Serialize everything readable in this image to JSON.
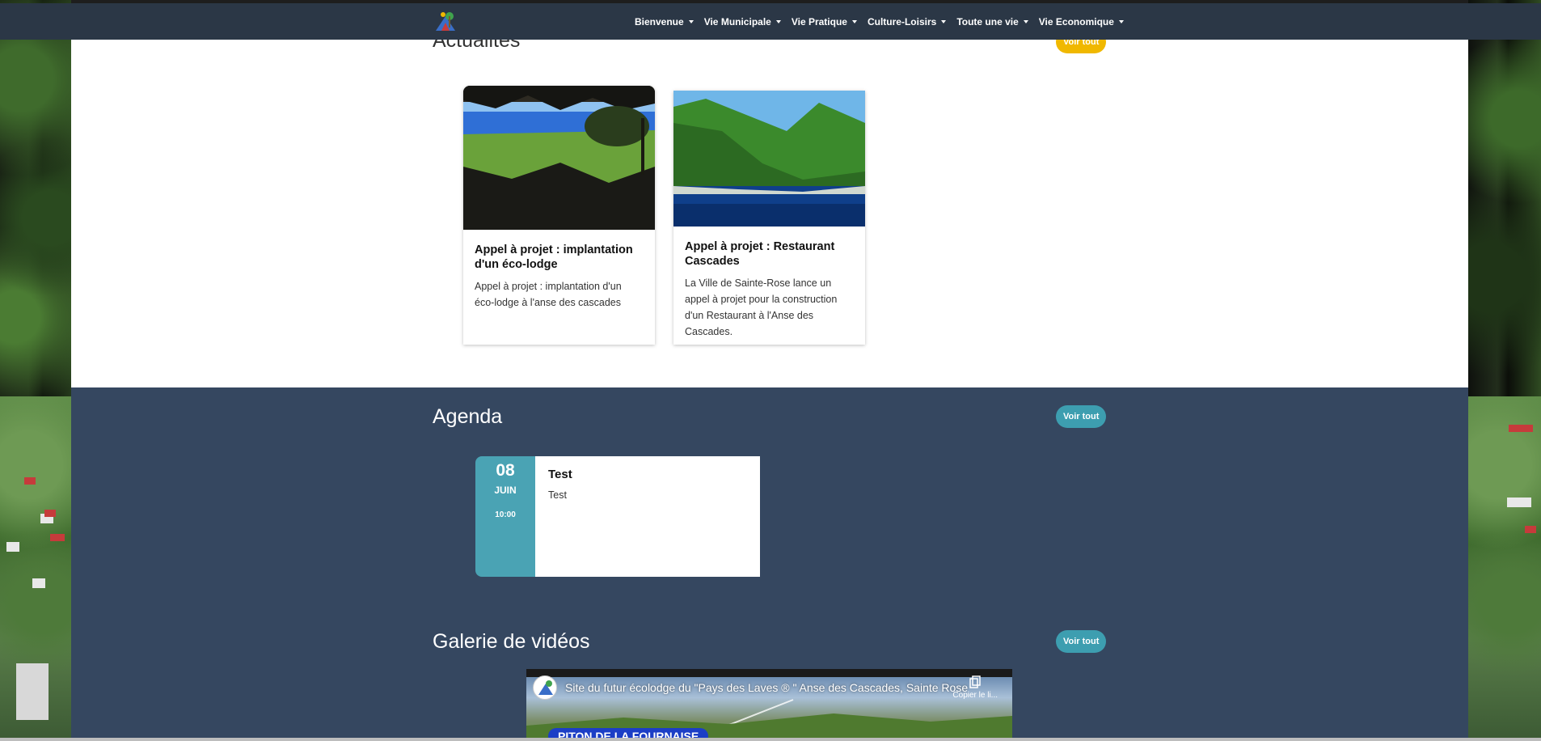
{
  "nav": {
    "logo_icon": "town-logo",
    "items": [
      {
        "label": "Bienvenue"
      },
      {
        "label": "Vie Municipale"
      },
      {
        "label": "Vie Pratique"
      },
      {
        "label": "Culture-Loisirs"
      },
      {
        "label": "Toute une vie"
      },
      {
        "label": "Vie Economique"
      }
    ]
  },
  "news": {
    "title": "Actualités",
    "see_all": "Voir tout",
    "cards": [
      {
        "title": "Appel à projet : implantation d'un éco-lodge",
        "text": "Appel à projet : implantation d'un éco-lodge à l'anse des cascades"
      },
      {
        "title": "Appel à projet : Restaurant Cascades",
        "text": "La Ville de Sainte-Rose lance un appel à projet pour la construction d'un Restaurant à l'Anse des Cascades."
      }
    ]
  },
  "agenda": {
    "title": "Agenda",
    "see_all": "Voir tout",
    "event": {
      "day": "08",
      "month": "JUIN",
      "time": "10:00",
      "title": "Test",
      "description": "Test"
    }
  },
  "videos": {
    "title": "Galerie de vidéos",
    "see_all": "Voir tout",
    "video": {
      "title": "Site du futur écolodge du \"Pays des Laves ® \" Anse des Cascades, Sainte Rose",
      "copy_label": "Copier le li...",
      "overlay_tag": "PITON DE LA FOURNAISE"
    }
  },
  "colors": {
    "navbar": "#2b3746",
    "dark_section": "#354760",
    "yellow_pill": "#f0b800",
    "teal_pill": "#3d9eb0"
  }
}
